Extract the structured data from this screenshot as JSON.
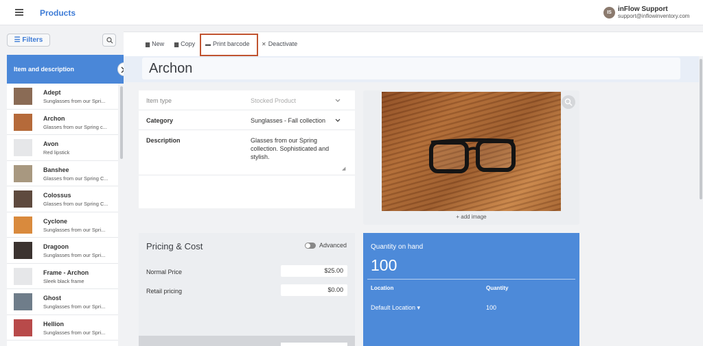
{
  "header": {
    "app_title": "Products",
    "user": {
      "initials": "IS",
      "name": "inFlow Support",
      "email": "support@inflowinventory.com"
    }
  },
  "sidebar": {
    "filters_label": "Filters",
    "list_header": "Item and description",
    "items": [
      {
        "name": "Adept",
        "desc": "Sunglasses from our Spri...",
        "thumb_color": "#8a6b55"
      },
      {
        "name": "Archon",
        "desc": "Glasses from our Spring c...",
        "thumb_color": "#b56a3a"
      },
      {
        "name": "Avon",
        "desc": "Red lipstick",
        "thumb_color": "#e6e7e9"
      },
      {
        "name": "Banshee",
        "desc": "Glasses from our Spring C...",
        "thumb_color": "#a89880"
      },
      {
        "name": "Colossus",
        "desc": "Glasses from our Spring C...",
        "thumb_color": "#5e4a3e"
      },
      {
        "name": "Cyclone",
        "desc": "Sunglasses from our Spri...",
        "thumb_color": "#d98a3d"
      },
      {
        "name": "Dragoon",
        "desc": "Sunglasses from our Spri...",
        "thumb_color": "#3b3330"
      },
      {
        "name": "Frame - Archon",
        "desc": "Sleek black frame",
        "thumb_color": "#e6e7e9"
      },
      {
        "name": "Ghost",
        "desc": "Sunglasses from our Spri...",
        "thumb_color": "#6f7d8a"
      },
      {
        "name": "Hellion",
        "desc": "Sunglasses from our Spri...",
        "thumb_color": "#b84a4a"
      }
    ]
  },
  "toolbar": {
    "new_label": "New",
    "copy_label": "Copy",
    "print_barcode_label": "Print barcode",
    "deactivate_label": "Deactivate"
  },
  "product": {
    "title": "Archon",
    "item_type_label": "Item type",
    "item_type_value": "Stocked Product",
    "category_label": "Category",
    "category_value": "Sunglasses - Fall collection",
    "description_label": "Description",
    "description_value": "Glasses from our Spring collection. Sophisticated and stylish.",
    "add_image_label": "+ add image"
  },
  "pricing": {
    "title": "Pricing & Cost",
    "advanced_label": "Advanced",
    "normal_price_label": "Normal Price",
    "normal_price_value": "$25.00",
    "retail_pricing_label": "Retail pricing",
    "retail_pricing_value": "$0.00"
  },
  "quantity": {
    "title": "Quantity on hand",
    "value": "100",
    "col_location": "Location",
    "col_quantity": "Quantity",
    "row_location": "Default Location ▾",
    "row_quantity": "100"
  },
  "colors": {
    "accent": "#4a87d8",
    "highlight_box": "#c0532f"
  }
}
